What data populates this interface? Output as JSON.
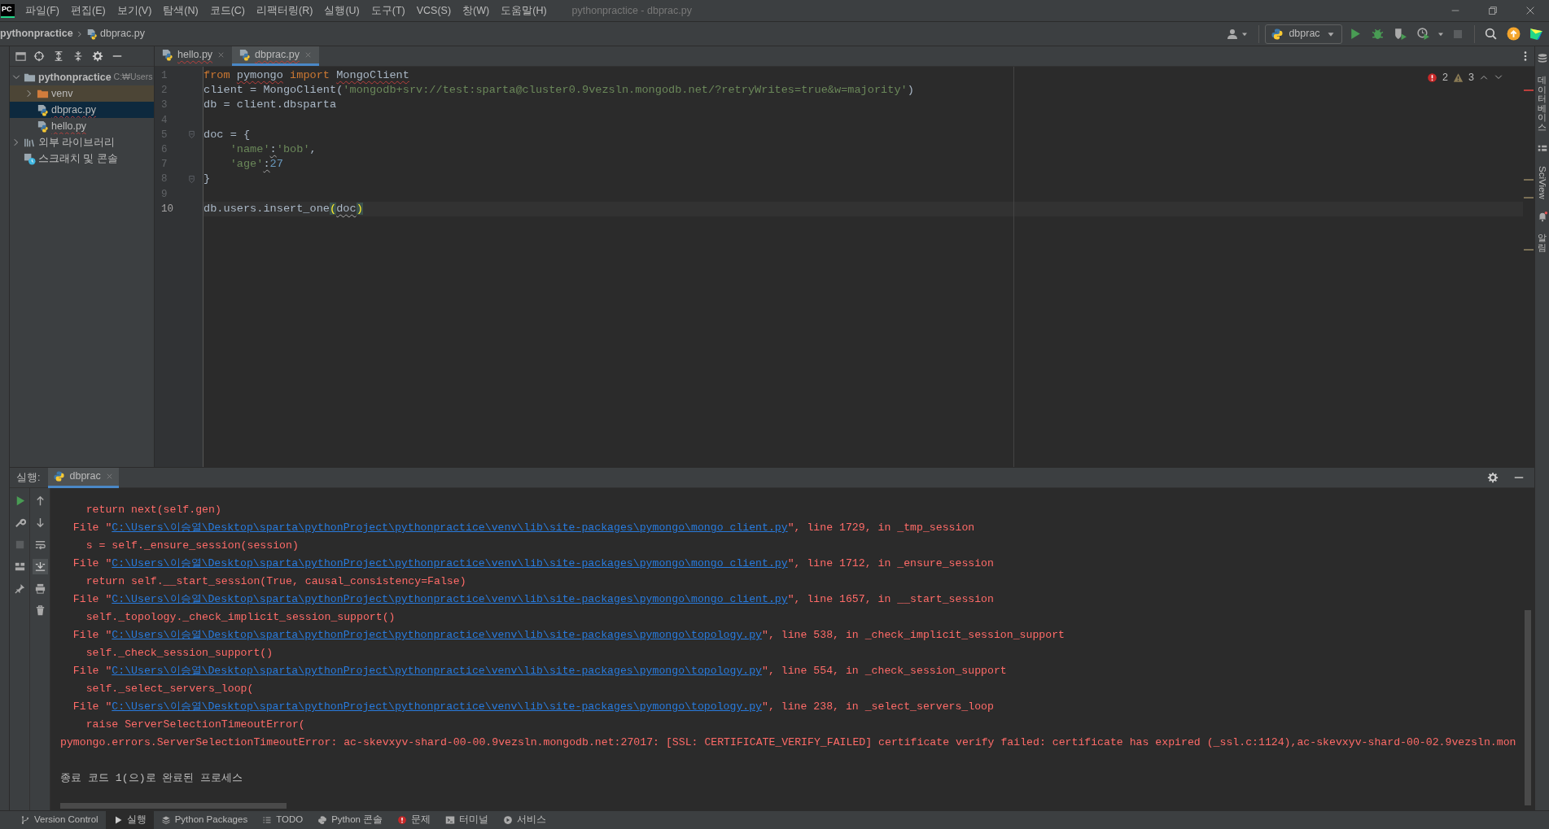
{
  "window": {
    "app_icon": "PC",
    "title": "pythonpractice - dbprac.py"
  },
  "menu": [
    "파일(F)",
    "편집(E)",
    "보기(V)",
    "탐색(N)",
    "코드(C)",
    "리팩터링(R)",
    "실행(U)",
    "도구(T)",
    "VCS(S)",
    "창(W)",
    "도움말(H)"
  ],
  "breadcrumb": [
    "pythonpractice",
    "dbprac.py"
  ],
  "toolbar": {
    "run_config": "dbprac"
  },
  "project_tree": [
    {
      "label": "pythonpractice",
      "path": "C:₩Users",
      "kind": "project",
      "expanded": true,
      "selected": false,
      "children": [
        {
          "label": "venv",
          "kind": "excluded_folder",
          "expanded": false,
          "selected": false
        },
        {
          "label": "dbprac.py",
          "kind": "python_file",
          "selected": true
        },
        {
          "label": "hello.py",
          "kind": "python_file",
          "selected": false
        }
      ]
    },
    {
      "label": "외부 라이브러리",
      "kind": "library",
      "expanded": false,
      "selected": false
    },
    {
      "label": "스크래치 및 콘솔",
      "kind": "scratch",
      "selected": false
    }
  ],
  "editor_tabs": [
    {
      "label": "hello.py",
      "selected": false
    },
    {
      "label": "dbprac.py",
      "selected": true
    }
  ],
  "inspections": {
    "errors": "2",
    "warnings": "3"
  },
  "code_lines": [
    {
      "number": "1",
      "current": false,
      "fold": false,
      "indented": false,
      "tokens": [
        {
          "text": "from ",
          "kind": "keyword"
        },
        {
          "text": "pymongo",
          "kind": "flagged"
        },
        {
          "text": " import ",
          "kind": "keyword"
        },
        {
          "text": "MongoClient",
          "kind": "flagged"
        }
      ]
    },
    {
      "number": "2",
      "current": false,
      "fold": false,
      "indented": false,
      "tokens": [
        {
          "text": "client = MongoClient(",
          "kind": "plain"
        },
        {
          "text": "'mongodb+srv://test:sparta@cluster0.9vezsln.mongodb.net/?retryWrites=true&w=majority'",
          "kind": "string"
        },
        {
          "text": ")",
          "kind": "plain"
        }
      ]
    },
    {
      "number": "3",
      "current": false,
      "fold": false,
      "indented": false,
      "tokens": [
        {
          "text": "db = client.dbsparta",
          "kind": "plain"
        }
      ]
    },
    {
      "number": "4",
      "current": false,
      "fold": false
    },
    {
      "number": "5",
      "current": false,
      "fold": true,
      "indented": false,
      "tokens": [
        {
          "text": "doc = {",
          "kind": "plain"
        }
      ]
    },
    {
      "number": "6",
      "current": false,
      "fold": false,
      "indented": true,
      "tokens": [
        {
          "text": "'name'",
          "kind": "string"
        },
        {
          "text": ":",
          "kind": "weak"
        },
        {
          "text": "'bob'",
          "kind": "string"
        },
        {
          "text": ",",
          "kind": "plain"
        }
      ]
    },
    {
      "number": "7",
      "current": false,
      "fold": false,
      "indented": true,
      "tokens": [
        {
          "text": "'age'",
          "kind": "string"
        },
        {
          "text": ":",
          "kind": "weak"
        },
        {
          "text": "27",
          "kind": "number"
        }
      ]
    },
    {
      "number": "8",
      "current": false,
      "fold": true,
      "indented": false,
      "tokens": [
        {
          "text": "}",
          "kind": "plain"
        }
      ]
    },
    {
      "number": "9",
      "current": false,
      "fold": false
    },
    {
      "number": "10",
      "current": true,
      "fold": false,
      "indented": false,
      "tokens": [
        {
          "text": "db.users.insert_one",
          "kind": "plain"
        },
        {
          "text": "(",
          "kind": "brace"
        },
        {
          "text": "doc",
          "kind": "weak"
        },
        {
          "text": ")",
          "kind": "brace"
        }
      ]
    }
  ],
  "run_panel": {
    "label": "실행:",
    "tab": "dbprac",
    "lines": [
      {
        "kind": "text",
        "text": "    return next(self.gen)"
      },
      {
        "kind": "frame",
        "prefix": "  File \"",
        "path": "C:\\Users\\이승열\\Desktop\\sparta\\pythonProject\\pythonpractice\\venv\\lib\\site-packages\\pymongo\\mongo_client.py",
        "suffix": "\", line 1729, in _tmp_session"
      },
      {
        "kind": "text",
        "text": "    s = self._ensure_session(session)"
      },
      {
        "kind": "frame",
        "prefix": "  File \"",
        "path": "C:\\Users\\이승열\\Desktop\\sparta\\pythonProject\\pythonpractice\\venv\\lib\\site-packages\\pymongo\\mongo_client.py",
        "suffix": "\", line 1712, in _ensure_session"
      },
      {
        "kind": "text",
        "text": "    return self.__start_session(True, causal_consistency=False)"
      },
      {
        "kind": "frame",
        "prefix": "  File \"",
        "path": "C:\\Users\\이승열\\Desktop\\sparta\\pythonProject\\pythonpractice\\venv\\lib\\site-packages\\pymongo\\mongo_client.py",
        "suffix": "\", line 1657, in __start_session"
      },
      {
        "kind": "text",
        "text": "    self._topology._check_implicit_session_support()"
      },
      {
        "kind": "frame",
        "prefix": "  File \"",
        "path": "C:\\Users\\이승열\\Desktop\\sparta\\pythonProject\\pythonpractice\\venv\\lib\\site-packages\\pymongo\\topology.py",
        "suffix": "\", line 538, in _check_implicit_session_support"
      },
      {
        "kind": "text",
        "text": "    self._check_session_support()"
      },
      {
        "kind": "frame",
        "prefix": "  File \"",
        "path": "C:\\Users\\이승열\\Desktop\\sparta\\pythonProject\\pythonpractice\\venv\\lib\\site-packages\\pymongo\\topology.py",
        "suffix": "\", line 554, in _check_session_support"
      },
      {
        "kind": "text",
        "text": "    self._select_servers_loop("
      },
      {
        "kind": "frame",
        "prefix": "  File \"",
        "path": "C:\\Users\\이승열\\Desktop\\sparta\\pythonProject\\pythonpractice\\venv\\lib\\site-packages\\pymongo\\topology.py",
        "suffix": "\", line 238, in _select_servers_loop"
      },
      {
        "kind": "text",
        "text": "    raise ServerSelectionTimeoutError("
      },
      {
        "kind": "text",
        "text": "pymongo.errors.ServerSelectionTimeoutError: ac-skevxyv-shard-00-00.9vezsln.mongodb.net:27017: [SSL: CERTIFICATE_VERIFY_FAILED] certificate verify failed: certificate has expired (_ssl.c:1124),ac-skevxyv-shard-00-02.9vezsln.mon"
      },
      {
        "kind": "exit",
        "text": "종료 코드 1(으)로 완료된 프로세스"
      }
    ]
  },
  "right_strip": [
    {
      "label": "데이터베이스",
      "kind": "stacked"
    },
    {
      "label": "SciView",
      "kind": "rotated"
    },
    {
      "label": "알림",
      "kind": "stacked"
    }
  ],
  "tool_windows": [
    {
      "label": "Version Control",
      "selected": false
    },
    {
      "label": "실행",
      "selected": true
    },
    {
      "label": "Python Packages",
      "selected": false
    },
    {
      "label": "TODO",
      "selected": false
    },
    {
      "label": "Python 콘솔",
      "selected": false
    },
    {
      "label": "문제",
      "selected": false
    },
    {
      "label": "터미널",
      "selected": false
    },
    {
      "label": "서비스",
      "selected": false
    }
  ]
}
